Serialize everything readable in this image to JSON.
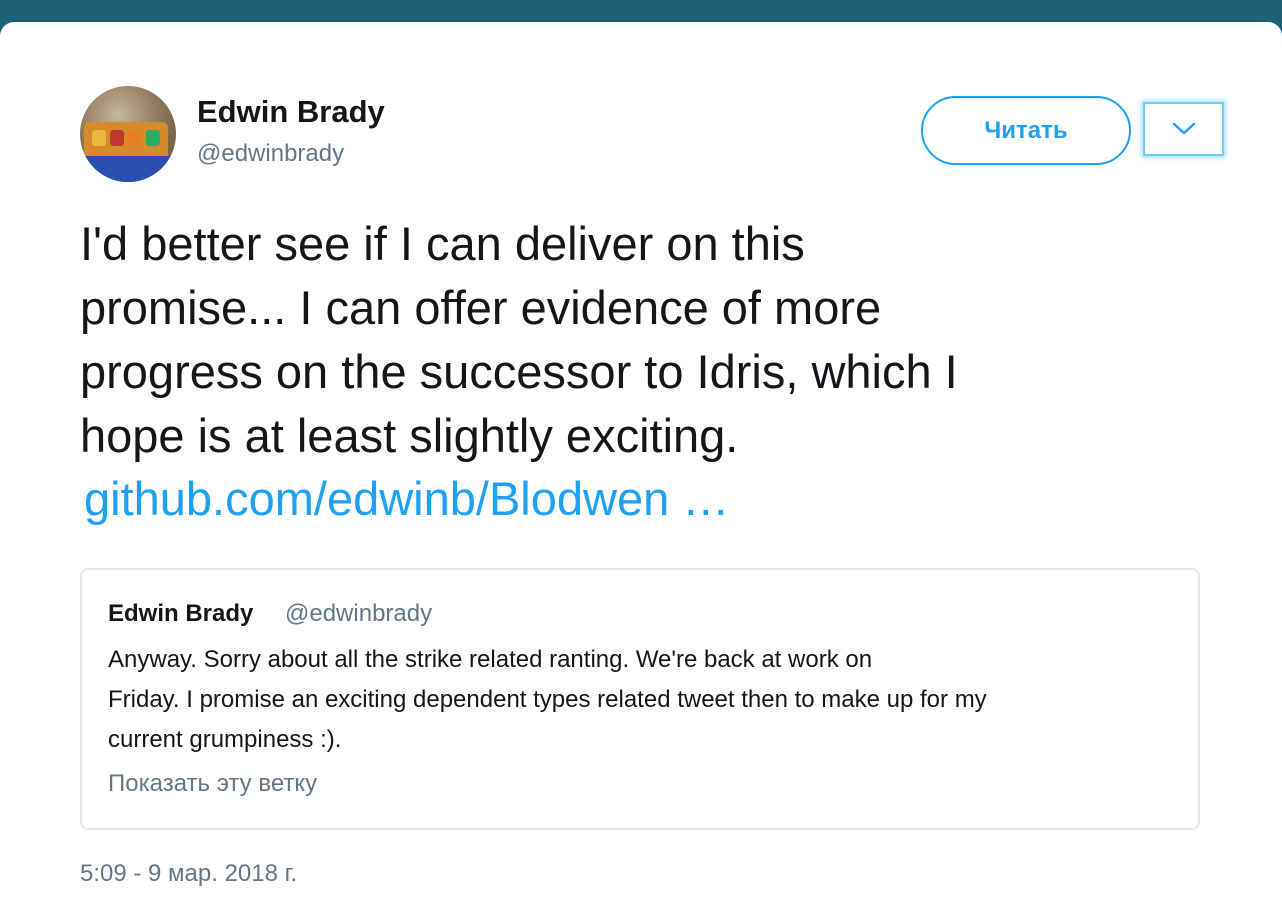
{
  "author": {
    "name": "Edwin Brady",
    "handle": "@edwinbrady"
  },
  "follow_label": "Читать",
  "tweet": {
    "lines": [
      "I'd better see if I can deliver on this",
      "promise... I can offer evidence of more",
      "progress on the successor to Idris, which I",
      "hope is at least slightly exciting."
    ],
    "link_text": "github.com/edwinb/Blodwen …"
  },
  "quoted_tweet": {
    "name": "Edwin Brady",
    "handle": "@edwinbrady",
    "lines": [
      "Anyway. Sorry about all the strike related ranting. We're back at work on",
      "Friday. I promise an exciting dependent types related tweet then to make up for my",
      "current grumpiness :)."
    ],
    "show_thread": "Показать эту ветку"
  },
  "timestamp": "5:09 - 9 мар. 2018 г.",
  "colors": {
    "accent": "#1da1f2",
    "text": "#14171a",
    "muted": "#657786",
    "page_bg": "#1e6074"
  },
  "icons": [
    "chevron-down-icon"
  ]
}
